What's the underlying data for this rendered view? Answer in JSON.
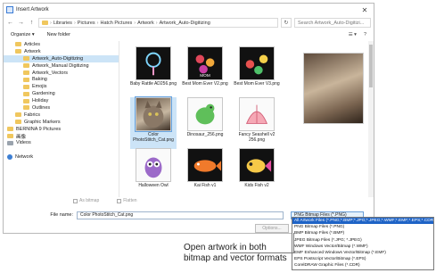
{
  "window": {
    "title": "Insert Artwork",
    "close_glyph": "✕"
  },
  "address": {
    "back": "←",
    "forward": "→",
    "up": "↑",
    "path": [
      "Libraries",
      "Pictures",
      "Hatch Pictures",
      "Artwork",
      "Artwork_Auto-Digitizing"
    ],
    "search_placeholder": "Search Artwork_Auto-Digitizi..."
  },
  "command_bar": {
    "organize": "Organize ▾",
    "new_folder": "New folder",
    "view_glyph": "☰ ▾",
    "help_glyph": "?"
  },
  "nav": {
    "items": [
      {
        "label": "Articles",
        "type": "folder",
        "indent": 1
      },
      {
        "label": "Artwork",
        "type": "folder",
        "indent": 1
      },
      {
        "label": "Artwork_Auto-Digitizing",
        "type": "folder",
        "indent": 2,
        "selected": true
      },
      {
        "label": "Artwork_Manual Digitizing",
        "type": "folder",
        "indent": 2
      },
      {
        "label": "Artwork_Vectors",
        "type": "folder",
        "indent": 2
      },
      {
        "label": "Baking",
        "type": "folder",
        "indent": 2
      },
      {
        "label": "Emojis",
        "type": "folder",
        "indent": 2
      },
      {
        "label": "Gardening",
        "type": "folder",
        "indent": 2
      },
      {
        "label": "Holiday",
        "type": "folder",
        "indent": 2
      },
      {
        "label": "Outlines",
        "type": "folder",
        "indent": 2
      },
      {
        "label": "Fabrics",
        "type": "folder",
        "indent": 1
      },
      {
        "label": "Graphic Markers",
        "type": "folder",
        "indent": 1
      },
      {
        "label": "BERNINA 9 Pictures",
        "type": "folder",
        "indent": 0
      },
      {
        "label": "画像",
        "type": "folder",
        "indent": 0
      },
      {
        "label": "Videos",
        "type": "drive",
        "indent": 0
      },
      {
        "label": "",
        "type": "blank",
        "indent": 0
      },
      {
        "label": "Network",
        "type": "network",
        "indent": 0
      }
    ]
  },
  "files": [
    {
      "label": "Baby Rattle AD256.png",
      "kind": "dark",
      "art": "rattle"
    },
    {
      "label": "Best Mom Ever V2.png",
      "kind": "dark",
      "art": "flowers"
    },
    {
      "label": "Best Mom Ever V3.png",
      "kind": "dark",
      "art": "flowers2"
    },
    {
      "label": "Color PhotoStitch_Cat.png",
      "kind": "photo",
      "art": "cat",
      "selected": true
    },
    {
      "label": "Dinosaur_256.png",
      "kind": "light",
      "art": "dino"
    },
    {
      "label": "Fancy Seashell v2 256.png",
      "kind": "light",
      "art": "shell"
    },
    {
      "label": "Halloween Owl",
      "kind": "light",
      "art": "owl"
    },
    {
      "label": "Kai Fish v1",
      "kind": "dark",
      "art": "koi"
    },
    {
      "label": "Kids Fish v2",
      "kind": "dark",
      "art": "fish"
    }
  ],
  "options": {
    "as_bitmap": "As bitmap",
    "flatten": "Flatten"
  },
  "file_name": {
    "label": "File name:",
    "value": "Color PhotoStitch_Cat.png"
  },
  "filter": {
    "value": "PNG Bitmap Files (*.PNG)"
  },
  "buttons": {
    "options": "Options..."
  },
  "dropdown": {
    "items": [
      "All Artwork Files (*.PNG;*.BMP;*.JPG;*.JPEG;*.WMF;*.EMF;*.EPS;*.CDR)",
      "PNG Bitmap Files (*.PNG)",
      "BMP Bitmap Files (*.BMP)",
      "JPEG Bitmap Files (*.JPG; *.JPEG)",
      "WMF Windows Vector/Bitmap (*.WMF)",
      "EMF Enhanced Windows Vector/Bitmap (*.EMF)",
      "EPS Postscript Vector/Bitmap (*.EPS)",
      "CorelDRAW Graphic Files (*.CDR)"
    ],
    "selected_index": 0
  },
  "caption": {
    "line1": "Open artwork in both",
    "line2": "bitmap and vector formats"
  }
}
